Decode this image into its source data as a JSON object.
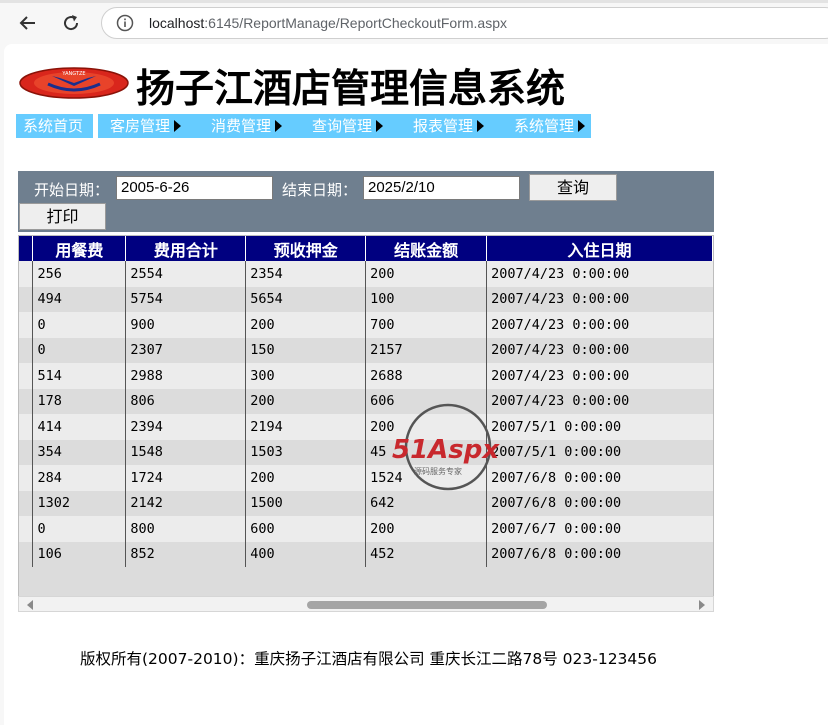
{
  "browser": {
    "url_host": "localhost",
    "url_rest": ":6145/ReportManage/ReportCheckoutForm.aspx"
  },
  "site": {
    "title": "扬子江酒店管理信息系统",
    "logo_text": "YANGTZE"
  },
  "menu": {
    "home": "系统首页",
    "items": [
      "客房管理",
      "消费管理",
      "查询管理",
      "报表管理",
      "系统管理"
    ]
  },
  "search": {
    "start_label": "开始日期：",
    "start_value": "2005-6-26",
    "end_label": "结束日期：",
    "end_value": "2025/2/10",
    "query_button": "查询",
    "print_button": "打印"
  },
  "table": {
    "columns": [
      "用餐费",
      "费用合计",
      "预收押金",
      "结账金额",
      "入住日期"
    ],
    "rows": [
      [
        "256",
        "2554",
        "2354",
        "200",
        "2007/4/23 0:00:00"
      ],
      [
        "494",
        "5754",
        "5654",
        "100",
        "2007/4/23 0:00:00"
      ],
      [
        "0",
        "900",
        "200",
        "700",
        "2007/4/23 0:00:00"
      ],
      [
        "0",
        "2307",
        "150",
        "2157",
        "2007/4/23 0:00:00"
      ],
      [
        "514",
        "2988",
        "300",
        "2688",
        "2007/4/23 0:00:00"
      ],
      [
        "178",
        "806",
        "200",
        "606",
        "2007/4/23 0:00:00"
      ],
      [
        "414",
        "2394",
        "2194",
        "200",
        "2007/5/1 0:00:00"
      ],
      [
        "354",
        "1548",
        "1503",
        "45",
        "2007/5/1 0:00:00"
      ],
      [
        "284",
        "1724",
        "200",
        "1524",
        "2007/6/8 0:00:00"
      ],
      [
        "1302",
        "2142",
        "1500",
        "642",
        "2007/6/8 0:00:00"
      ],
      [
        "0",
        "800",
        "600",
        "200",
        "2007/6/7 0:00:00"
      ],
      [
        "106",
        "852",
        "400",
        "452",
        "2007/6/8 0:00:00"
      ]
    ]
  },
  "watermark": {
    "brand": "51Aspx",
    "tagline": "源码服务专家"
  },
  "footer": {
    "text": "版权所有(2007-2010)：重庆扬子江酒店有限公司 重庆长江二路78号 023-123456"
  },
  "colors": {
    "menu_bg": "#66ccff",
    "panel_bg": "#6f7f8f",
    "header_bg": "#000080"
  }
}
